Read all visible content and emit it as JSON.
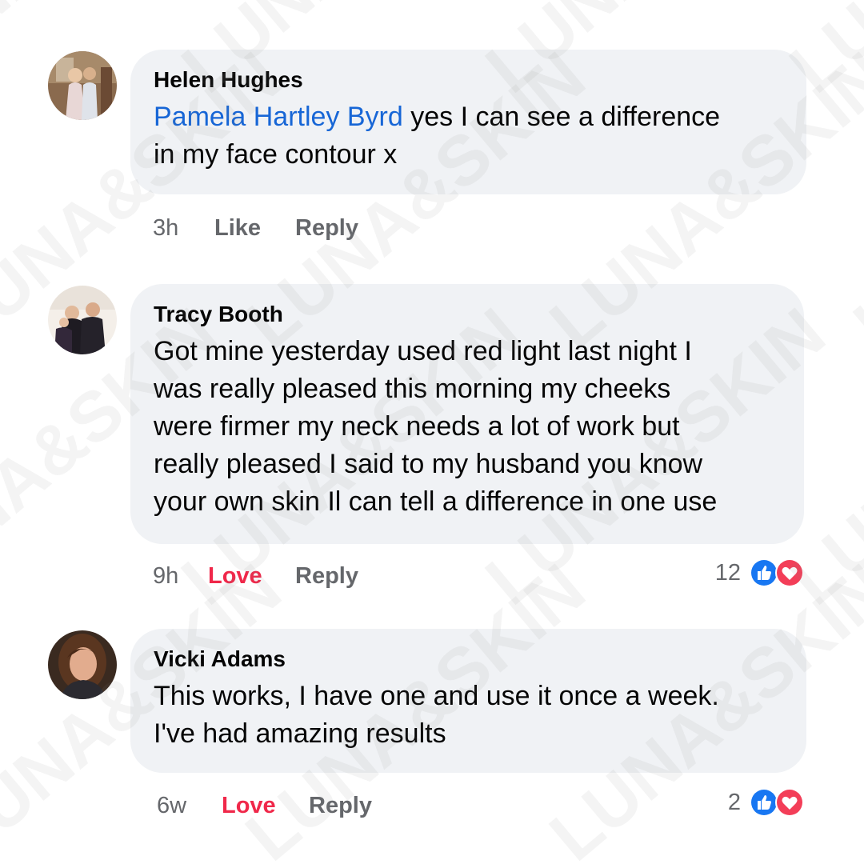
{
  "watermark": {
    "text": "LUNA&SKIN"
  },
  "comments": [
    {
      "author": "Helen Hughes",
      "mention": "Pamela Hartley Byrd",
      "text_line1": "yes I can see a difference",
      "text_line2": "in my face contour x",
      "time": "3h",
      "action_like": "Like",
      "action_reply": "Reply"
    },
    {
      "author": "Tracy Booth",
      "lines": [
        "Got mine yesterday used red light last night I",
        "was really pleased this morning my cheeks",
        "were firmer my neck needs a lot of work but",
        "really pleased I said to my husband you know",
        "your own skin Il can tell a difference in one use"
      ],
      "time": "9h",
      "action_love": "Love",
      "action_reply": "Reply",
      "reaction_count": "12",
      "reaction_icons": [
        "like-icon",
        "heart-icon"
      ]
    },
    {
      "author": "Vicki Adams",
      "lines": [
        "This works, I have one and use it once a week.",
        "I've had amazing results"
      ],
      "time": "6w",
      "action_love": "Love",
      "action_reply": "Reply",
      "reaction_count": "2",
      "reaction_icons": [
        "like-icon",
        "heart-icon"
      ]
    }
  ],
  "colors": {
    "bubble_bg": "#f0f2f5",
    "mention": "#1766d6",
    "love": "#f0284a",
    "muted": "#65676b",
    "like_blue": "#1877f2",
    "heart_red": "#f33e58"
  }
}
